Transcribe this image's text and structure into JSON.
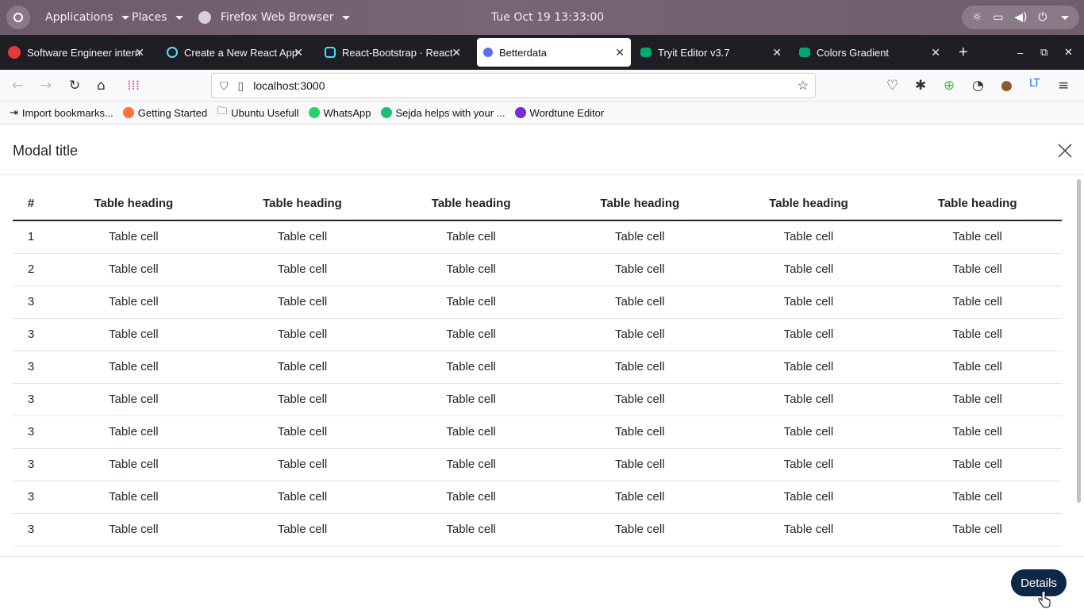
{
  "system": {
    "menus": [
      "Applications",
      "Places",
      "Firefox Web Browser"
    ],
    "clock": "Tue Oct 19  13:33:00"
  },
  "tabs": [
    {
      "title": "Software Engineer intern",
      "color": "#e03a3a"
    },
    {
      "title": "Create a New React App",
      "color": "#61dafb"
    },
    {
      "title": "React-Bootstrap · React",
      "color": "#41e0fd"
    },
    {
      "title": "Betterdata",
      "color": "#5a6cf0"
    },
    {
      "title": "Tryit Editor v3.7",
      "color": "#04aa6d"
    },
    {
      "title": "Colors Gradient",
      "color": "#04aa6d"
    }
  ],
  "address": {
    "url": "localhost:3000"
  },
  "bookmarks": [
    {
      "label": "Import bookmarks...",
      "color": "#444444"
    },
    {
      "label": "Getting Started",
      "color": "#ff7139"
    },
    {
      "label": "Ubuntu Usefull",
      "color": "#666666"
    },
    {
      "label": "WhatsApp",
      "color": "#25d366"
    },
    {
      "label": "Sejda helps with your ...",
      "color": "#1dbf73"
    },
    {
      "label": "Wordtune Editor",
      "color": "#7a2bd6"
    }
  ],
  "modal": {
    "title": "Modal title",
    "table": {
      "headers": [
        "#",
        "Table heading",
        "Table heading",
        "Table heading",
        "Table heading",
        "Table heading",
        "Table heading"
      ],
      "rows": [
        [
          "1",
          "Table cell",
          "Table cell",
          "Table cell",
          "Table cell",
          "Table cell",
          "Table cell"
        ],
        [
          "2",
          "Table cell",
          "Table cell",
          "Table cell",
          "Table cell",
          "Table cell",
          "Table cell"
        ],
        [
          "3",
          "Table cell",
          "Table cell",
          "Table cell",
          "Table cell",
          "Table cell",
          "Table cell"
        ],
        [
          "3",
          "Table cell",
          "Table cell",
          "Table cell",
          "Table cell",
          "Table cell",
          "Table cell"
        ],
        [
          "3",
          "Table cell",
          "Table cell",
          "Table cell",
          "Table cell",
          "Table cell",
          "Table cell"
        ],
        [
          "3",
          "Table cell",
          "Table cell",
          "Table cell",
          "Table cell",
          "Table cell",
          "Table cell"
        ],
        [
          "3",
          "Table cell",
          "Table cell",
          "Table cell",
          "Table cell",
          "Table cell",
          "Table cell"
        ],
        [
          "3",
          "Table cell",
          "Table cell",
          "Table cell",
          "Table cell",
          "Table cell",
          "Table cell"
        ],
        [
          "3",
          "Table cell",
          "Table cell",
          "Table cell",
          "Table cell",
          "Table cell",
          "Table cell"
        ],
        [
          "3",
          "Table cell",
          "Table cell",
          "Table cell",
          "Table cell",
          "Table cell",
          "Table cell"
        ]
      ]
    },
    "button_label": "Details",
    "button_color": "#0f2747"
  }
}
